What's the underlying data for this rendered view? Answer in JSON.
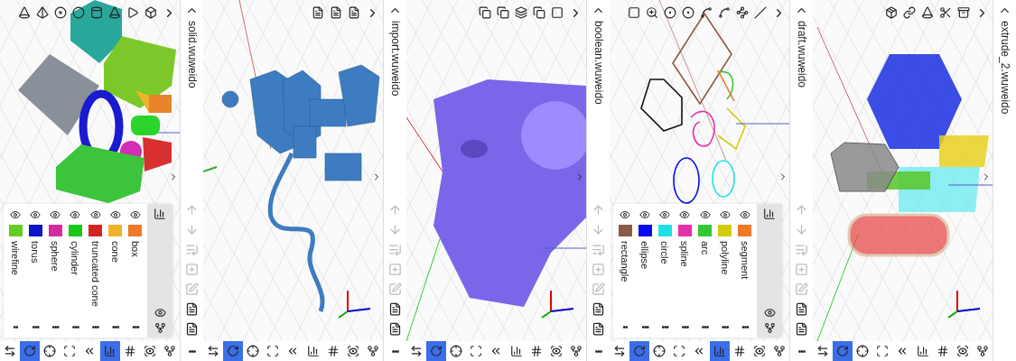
{
  "panels": [
    {
      "kind": "cut-left",
      "viewport": {
        "kind": "primitives"
      },
      "top_tools": [
        {
          "kind": "cone"
        },
        {
          "kind": "pyramid"
        },
        {
          "kind": "disc"
        },
        {
          "kind": "sphere"
        },
        {
          "kind": "cylinder"
        },
        {
          "kind": "cone"
        },
        {
          "kind": "play"
        },
        {
          "kind": "box"
        }
      ],
      "objects": [
        {
          "label": "wirefine",
          "color": "#66cc22",
          "visible": true,
          "menu": "••"
        },
        {
          "label": "torus",
          "color": "#0a14c8",
          "visible": true,
          "menu": "•••"
        },
        {
          "label": "sphere",
          "color": "#d42ca0",
          "visible": true,
          "menu": "•••"
        },
        {
          "label": "cylinder",
          "color": "#19c819",
          "visible": true,
          "menu": "•••"
        },
        {
          "label": "truncated cone",
          "color": "#d42424",
          "visible": true,
          "menu": "•••"
        },
        {
          "label": "cone",
          "color": "#f0b428",
          "visible": true,
          "menu": "•••"
        },
        {
          "label": "box",
          "color": "#f07828",
          "visible": true,
          "menu": "•••"
        }
      ],
      "bottom_tools": [
        {
          "kind": "swap",
          "selected": false
        },
        {
          "kind": "rotate",
          "selected": true
        },
        {
          "kind": "pan",
          "selected": false
        },
        {
          "kind": "fit",
          "selected": false
        },
        {
          "kind": "layers",
          "selected": false
        },
        {
          "kind": "chart",
          "selected": true
        },
        {
          "kind": "grid",
          "selected": false
        },
        {
          "kind": "target",
          "selected": false
        },
        {
          "kind": "fork",
          "selected": false
        }
      ]
    },
    {
      "kind": "full",
      "filename": "solid.wuweido",
      "more": "•••",
      "viewport": {
        "kind": "assembly"
      },
      "top_tools": [
        {
          "kind": "note"
        },
        {
          "kind": "note"
        },
        {
          "kind": "note"
        }
      ],
      "side_tools": [
        {
          "kind": "up",
          "disabled": true
        },
        {
          "kind": "down",
          "disabled": true
        },
        {
          "kind": "list",
          "disabled": true
        },
        {
          "kind": "add",
          "disabled": true
        },
        {
          "kind": "edit",
          "disabled": true
        },
        {
          "kind": "file",
          "disabled": false
        },
        {
          "kind": "file",
          "disabled": false
        }
      ],
      "bottom_tools": [
        {
          "kind": "swap",
          "selected": false
        },
        {
          "kind": "rotate",
          "selected": true
        },
        {
          "kind": "pan",
          "selected": false
        },
        {
          "kind": "fit",
          "selected": false
        },
        {
          "kind": "layers",
          "selected": false
        },
        {
          "kind": "chart",
          "selected": false
        },
        {
          "kind": "grid",
          "selected": false
        },
        {
          "kind": "target",
          "selected": false
        },
        {
          "kind": "fork",
          "selected": false
        }
      ]
    },
    {
      "kind": "full",
      "filename": "import.wuweido",
      "more": "•••",
      "viewport": {
        "kind": "solid"
      },
      "top_tools": [
        {
          "kind": "stack"
        },
        {
          "kind": "stack"
        },
        {
          "kind": "layers"
        },
        {
          "kind": "stack"
        },
        {
          "kind": "square"
        }
      ],
      "side_tools": [
        {
          "kind": "up",
          "disabled": true
        },
        {
          "kind": "down",
          "disabled": true
        },
        {
          "kind": "list",
          "disabled": true
        },
        {
          "kind": "add",
          "disabled": true
        },
        {
          "kind": "edit",
          "disabled": true
        },
        {
          "kind": "file",
          "disabled": false
        },
        {
          "kind": "file",
          "disabled": false
        }
      ],
      "bottom_tools": [
        {
          "kind": "swap",
          "selected": false
        },
        {
          "kind": "rotate",
          "selected": true
        },
        {
          "kind": "pan",
          "selected": false
        },
        {
          "kind": "fit",
          "selected": false
        },
        {
          "kind": "layers",
          "selected": false
        },
        {
          "kind": "chart",
          "selected": false
        },
        {
          "kind": "grid",
          "selected": false
        },
        {
          "kind": "target",
          "selected": false
        },
        {
          "kind": "fork",
          "selected": false
        }
      ]
    },
    {
      "kind": "full",
      "filename": "boolean.wuweido",
      "more": "•••",
      "viewport": {
        "kind": "sketch"
      },
      "top_tools": [
        {
          "kind": "square"
        },
        {
          "kind": "zoom"
        },
        {
          "kind": "dot"
        },
        {
          "kind": "dot"
        },
        {
          "kind": "spline"
        },
        {
          "kind": "spline"
        },
        {
          "kind": "waypoints"
        },
        {
          "kind": "line"
        }
      ],
      "side_tools": [
        {
          "kind": "up",
          "disabled": true
        },
        {
          "kind": "down",
          "disabled": true
        },
        {
          "kind": "list",
          "disabled": true
        },
        {
          "kind": "add",
          "disabled": true
        },
        {
          "kind": "edit",
          "disabled": true
        },
        {
          "kind": "file",
          "disabled": false
        },
        {
          "kind": "file",
          "disabled": false
        }
      ],
      "objects": [
        {
          "label": "rectangle",
          "color": "#8c5a46",
          "visible": true,
          "menu": "••"
        },
        {
          "label": "ellipse",
          "color": "#0a0af0",
          "visible": true,
          "menu": "•••"
        },
        {
          "label": "circle",
          "color": "#1ee1e6",
          "visible": true,
          "menu": "•••"
        },
        {
          "label": "spline",
          "color": "#e632aa",
          "visible": true,
          "menu": "•••"
        },
        {
          "label": "arc",
          "color": "#32c832",
          "visible": true,
          "menu": "•••"
        },
        {
          "label": "polyline",
          "color": "#d2cd0a",
          "visible": true,
          "menu": "•••"
        },
        {
          "label": "segment",
          "color": "#f07828",
          "visible": true,
          "menu": "•••"
        }
      ],
      "bottom_tools": [
        {
          "kind": "swap",
          "selected": false
        },
        {
          "kind": "rotate",
          "selected": true
        },
        {
          "kind": "pan",
          "selected": false
        },
        {
          "kind": "fit",
          "selected": false
        },
        {
          "kind": "layers",
          "selected": false
        },
        {
          "kind": "chart",
          "selected": true
        },
        {
          "kind": "grid",
          "selected": false
        },
        {
          "kind": "target",
          "selected": false
        },
        {
          "kind": "fork",
          "selected": false
        }
      ]
    },
    {
      "kind": "full",
      "filename": "draft.wuweido",
      "more": "•••",
      "viewport": {
        "kind": "extrude"
      },
      "top_tools": [
        {
          "kind": "package"
        },
        {
          "kind": "link"
        },
        {
          "kind": "cone"
        },
        {
          "kind": "scissors"
        },
        {
          "kind": "archive"
        }
      ],
      "side_tools": [
        {
          "kind": "up",
          "disabled": true
        },
        {
          "kind": "down",
          "disabled": true
        },
        {
          "kind": "list",
          "disabled": true
        },
        {
          "kind": "add",
          "disabled": true
        },
        {
          "kind": "edit",
          "disabled": true
        },
        {
          "kind": "file",
          "disabled": false
        },
        {
          "kind": "file",
          "disabled": false
        }
      ],
      "bottom_tools": [
        {
          "kind": "swap",
          "selected": false
        },
        {
          "kind": "rotate",
          "selected": true
        },
        {
          "kind": "pan",
          "selected": false
        },
        {
          "kind": "fit",
          "selected": false
        },
        {
          "kind": "layers",
          "selected": false
        },
        {
          "kind": "chart",
          "selected": false
        },
        {
          "kind": "grid",
          "selected": false
        },
        {
          "kind": "target",
          "selected": false
        },
        {
          "kind": "fork",
          "selected": false
        }
      ]
    },
    {
      "kind": "cut-right",
      "filename": "extrude_2.wuweido"
    }
  ]
}
